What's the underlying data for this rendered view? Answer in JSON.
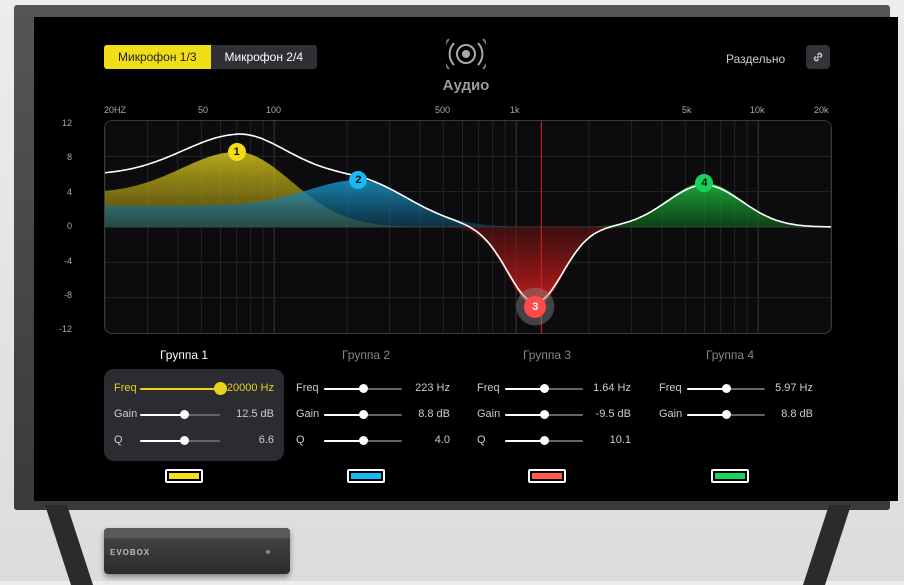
{
  "header": {
    "tabs": [
      {
        "label": "Микрофон 1/3",
        "active": true
      },
      {
        "label": "Микрофон 2/4",
        "active": false
      }
    ],
    "title": "Аудио",
    "separate_label": "Раздельно",
    "icons": {
      "audio": "speaker-icon",
      "link": "link-icon"
    }
  },
  "chart_data": {
    "type": "area",
    "x_scale": "log",
    "x_tick_labels": [
      "20HZ",
      "50",
      "100",
      "500",
      "1k",
      "5k",
      "10k",
      "20k"
    ],
    "y_tick_labels": [
      "12",
      "8",
      "4",
      "0",
      "-4",
      "-8",
      "-12"
    ],
    "ylim": [
      -12,
      12
    ],
    "xlim": [
      20,
      20000
    ],
    "grid": true,
    "marker_freq": "1.64 Hz",
    "handles": [
      {
        "id": "1",
        "freq": 70,
        "gain": 8.5,
        "color": "#f2dd19"
      },
      {
        "id": "2",
        "freq": 223,
        "gain": 5.3,
        "color": "#19b8f2"
      },
      {
        "id": "3",
        "freq": 1200,
        "gain": -9.0,
        "color": "#ff4a4a"
      },
      {
        "id": "4",
        "freq": 6000,
        "gain": 5.0,
        "color": "#19d25a"
      }
    ]
  },
  "groups": [
    {
      "title": "Группа 1",
      "active": true,
      "color": "#f2dd19",
      "rows": [
        {
          "label": "Freq",
          "value": "20000 Hz",
          "pos": 1.0
        },
        {
          "label": "Gain",
          "value": "12.5 dB",
          "pos": 0.55
        },
        {
          "label": "Q",
          "value": "6.6",
          "pos": 0.55
        }
      ]
    },
    {
      "title": "Группа 2",
      "active": false,
      "color": "#19b8f2",
      "rows": [
        {
          "label": "Freq",
          "value": "223 Hz",
          "pos": 0.5
        },
        {
          "label": "Gain",
          "value": "8.8 dB",
          "pos": 0.5
        },
        {
          "label": "Q",
          "value": "4.0",
          "pos": 0.5
        }
      ]
    },
    {
      "title": "Группа 3",
      "active": false,
      "color": "#ff5a4a",
      "rows": [
        {
          "label": "Freq",
          "value": "1.64 Hz",
          "pos": 0.5
        },
        {
          "label": "Gain",
          "value": "-9.5 dB",
          "pos": 0.5
        },
        {
          "label": "Q",
          "value": "10.1",
          "pos": 0.5
        }
      ]
    },
    {
      "title": "Группа 4",
      "active": false,
      "color": "#19d25a",
      "rows": [
        {
          "label": "Freq",
          "value": "5.97 Hz",
          "pos": 0.5
        },
        {
          "label": "Gain",
          "value": "8.8 dB",
          "pos": 0.5
        }
      ]
    }
  ],
  "device": {
    "logo": "EVOBOX"
  }
}
